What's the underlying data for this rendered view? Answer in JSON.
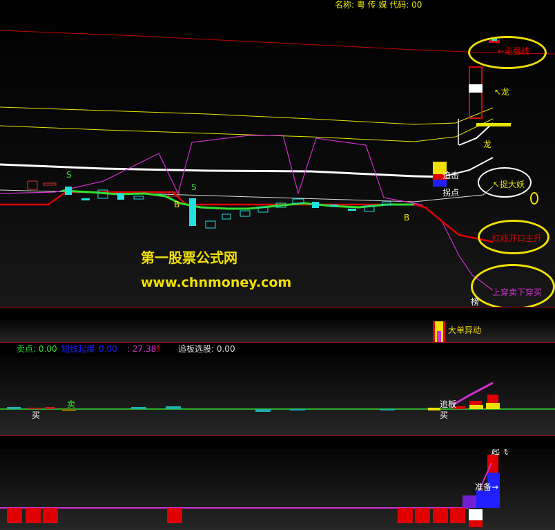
{
  "header": {
    "stock_name_label": "名称: 粤 传 媒 代码: 00"
  },
  "watermark": {
    "line1": "第一股票公式网",
    "line2": "www.chnmoney.com"
  },
  "main_chart": {
    "candle_marks": {
      "s1": "S",
      "s2": "S",
      "b1": "B",
      "b2": "B",
      "b3": "B"
    },
    "annotations": {
      "strong_line": "←走强线",
      "dragon1": "↖龙",
      "dragon2": "龙",
      "catch_demon": "↖捉大妖",
      "red_line_rise": "红线开口主升",
      "cross_buy": "上穿卖下穿买",
      "chase_point": "追击",
      "turn_point": "拐点",
      "rank_mark": "榜"
    }
  },
  "band_panel": {
    "big_order_label": "大单异动"
  },
  "indicator_panel_1": {
    "sell_point": "卖点: 0.00",
    "rally_start": "短线起爆",
    "rally_value": "0.00",
    "value_label": ": 27.38",
    "up_arrow": "↑",
    "chase_select": "追板选股: 0.00",
    "sell_mark": "卖",
    "buy_mark_1": "买",
    "chase_mark": "追板",
    "buy_mark_2": "买"
  },
  "indicator_panel_2": {
    "top_label": "起飞",
    "prepare_label": "准备→"
  },
  "colors": {
    "red_line": "#e00000",
    "yellow_line": "#e6e600",
    "white_line": "#ffffff",
    "magenta_line": "#d030d0",
    "green_line": "#30e030",
    "cyan_candle": "#20e0e0",
    "annotation_yellow": "#f0e000"
  }
}
